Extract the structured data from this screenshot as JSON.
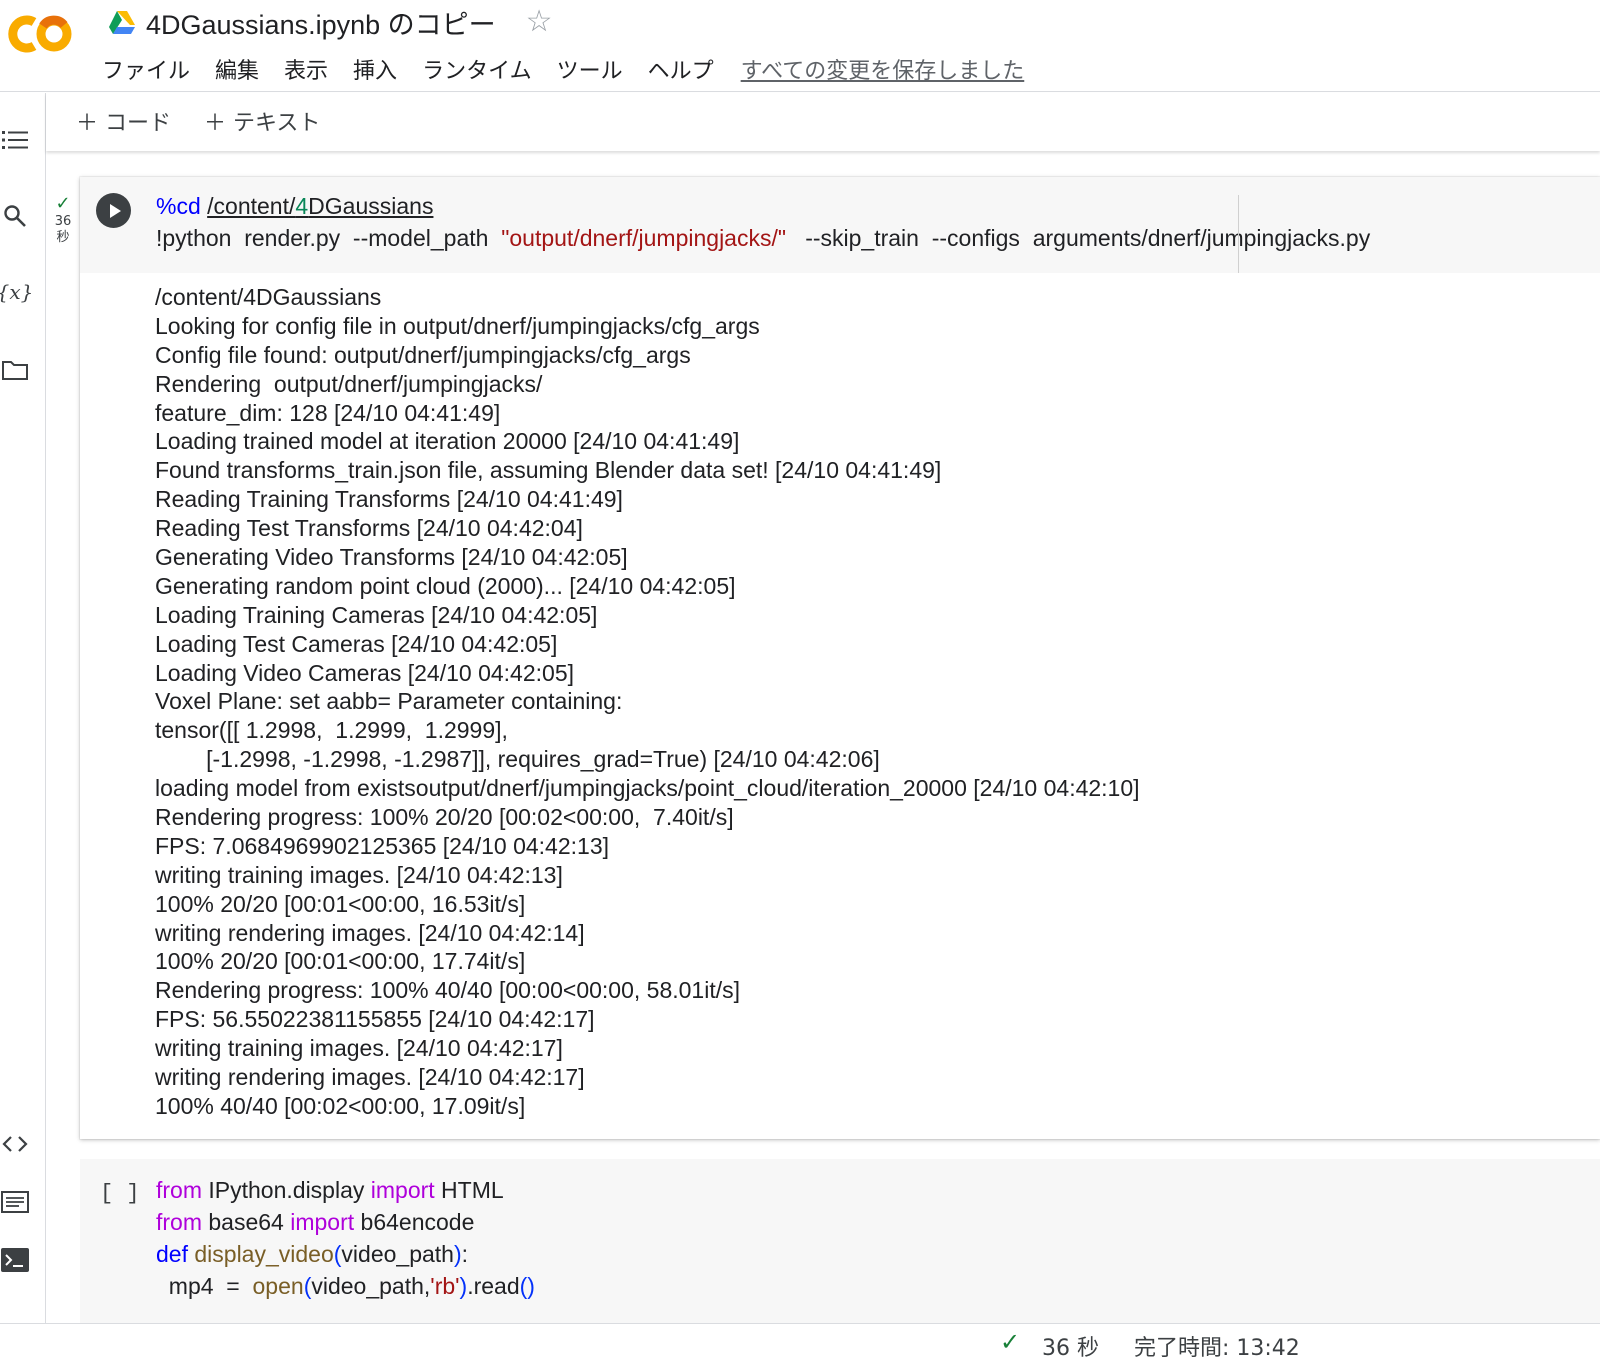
{
  "header": {
    "title": "4DGaussians.ipynb のコピー",
    "menu": [
      "ファイル",
      "編集",
      "表示",
      "挿入",
      "ランタイム",
      "ツール",
      "ヘルプ"
    ],
    "save_status": "すべての変更を保存しました"
  },
  "toolbar": {
    "add_code": "＋ コード",
    "add_text": "＋ テキスト"
  },
  "cell1": {
    "exec_secs": "36",
    "exec_unit": "秒",
    "code": {
      "l1_magic": "%cd",
      "l1_path_a": "/content/",
      "l1_path_num": "4",
      "l1_path_b": "DGaussians",
      "l2_cmd": "!python  render.py  --model_path  ",
      "l2_str": "\"output/dnerf/jumpingjacks/\"",
      "l2_rest": "   --skip_train  --configs  arguments/dnerf/jumpingjacks.py"
    },
    "output_lines": [
      "/content/4DGaussians",
      "Looking for config file in output/dnerf/jumpingjacks/cfg_args",
      "Config file found: output/dnerf/jumpingjacks/cfg_args",
      "Rendering  output/dnerf/jumpingjacks/",
      "feature_dim: 128 [24/10 04:41:49]",
      "Loading trained model at iteration 20000 [24/10 04:41:49]",
      "Found transforms_train.json file, assuming Blender data set! [24/10 04:41:49]",
      "Reading Training Transforms [24/10 04:41:49]",
      "Reading Test Transforms [24/10 04:42:04]",
      "Generating Video Transforms [24/10 04:42:05]",
      "Generating random point cloud (2000)... [24/10 04:42:05]",
      "Loading Training Cameras [24/10 04:42:05]",
      "Loading Test Cameras [24/10 04:42:05]",
      "Loading Video Cameras [24/10 04:42:05]",
      "Voxel Plane: set aabb= Parameter containing:",
      "tensor([[ 1.2998,  1.2999,  1.2999],",
      "        [-1.2998, -1.2998, -1.2987]], requires_grad=True) [24/10 04:42:06]",
      "loading model from existsoutput/dnerf/jumpingjacks/point_cloud/iteration_20000 [24/10 04:42:10]",
      "Rendering progress: 100% 20/20 [00:02<00:00,  7.40it/s]",
      "FPS: 7.068496990212536​5 [24/10 04:42:13]",
      "writing training images. [24/10 04:42:13]",
      "100% 20/20 [00:01<00:00, 16.53it/s]",
      "writing rendering images. [24/10 04:42:14]",
      "100% 20/20 [00:01<00:00, 17.74it/s]",
      "Rendering progress: 100% 40/40 [00:00<00:00, 58.01it/s]",
      "FPS: 56.55022381155855 [24/10 04:42:17]",
      "writing training images. [24/10 04:42:17]",
      "writing rendering images. [24/10 04:42:17]",
      "100% 40/40 [00:02<00:00, 17.09it/s]"
    ]
  },
  "cell2": {
    "bracket": "[ ]",
    "l1": {
      "kw1": "from",
      "mod": " IPython.display ",
      "kw2": "import",
      "name": " HTML"
    },
    "l2": {
      "kw1": "from",
      "mod": " base64 ",
      "kw2": "import",
      "name": " b64encode"
    },
    "l3": {
      "kw": "def",
      "fn": " display_video",
      "p_open": "(",
      "arg": "video_path",
      "p_close": ")",
      "colon": ":"
    },
    "l4": {
      "a": "  mp4  =  ",
      "fn": "open",
      "p_open": "(",
      "arg": "video_path,",
      "str": "'rb'",
      "p_close": ")",
      "b": ".read",
      "p2": "()"
    }
  },
  "statusbar": {
    "duration": "36 秒",
    "finished": "完了時間: 13:42"
  },
  "colors": {
    "accent_orange": "#f9ab00",
    "run_button": "#3c4043",
    "success_green": "#188038",
    "string_red": "#a31515",
    "keyword_purple": "#af00db",
    "keyword_blue": "#0000ff"
  }
}
